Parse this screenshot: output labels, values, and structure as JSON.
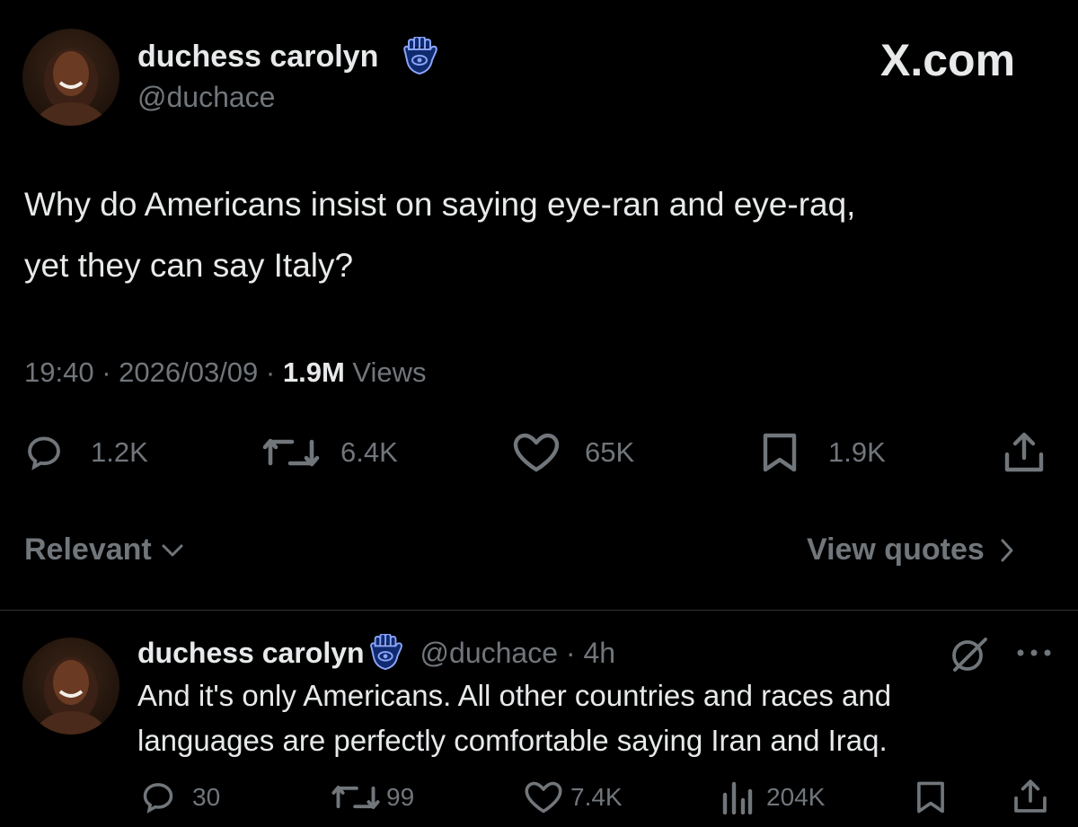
{
  "site_logo": "X.com",
  "post": {
    "author_name": "duchess carolyn",
    "author_handle": "@duchace",
    "badge_icon": "hamsa-icon",
    "text_line1": "Why do Americans insist on saying eye-ran and eye-raq,",
    "text_line2": "yet they can say Italy?",
    "time": "19:40",
    "date": "2026/03/09",
    "views_count": "1.9M",
    "views_label": "Views",
    "actions": {
      "replies": "1.2K",
      "reposts": "6.4K",
      "likes": "65K",
      "bookmarks": "1.9K"
    }
  },
  "filter": {
    "sort_label": "Relevant",
    "view_quotes_label": "View quotes"
  },
  "reply": {
    "author_name": "duchess carolyn",
    "author_handle": "@duchace",
    "age": "4h",
    "text_line1": "And it's only Americans. All other countries and races and",
    "text_line2": "languages are perfectly comfortable saying Iran and Iraq.",
    "actions": {
      "replies": "30",
      "reposts": "99",
      "likes": "7.4K",
      "views": "204K"
    }
  },
  "colors": {
    "background": "#000000",
    "text": "#e7e9ea",
    "muted": "#71767b",
    "badge": "#8aa4f8"
  }
}
